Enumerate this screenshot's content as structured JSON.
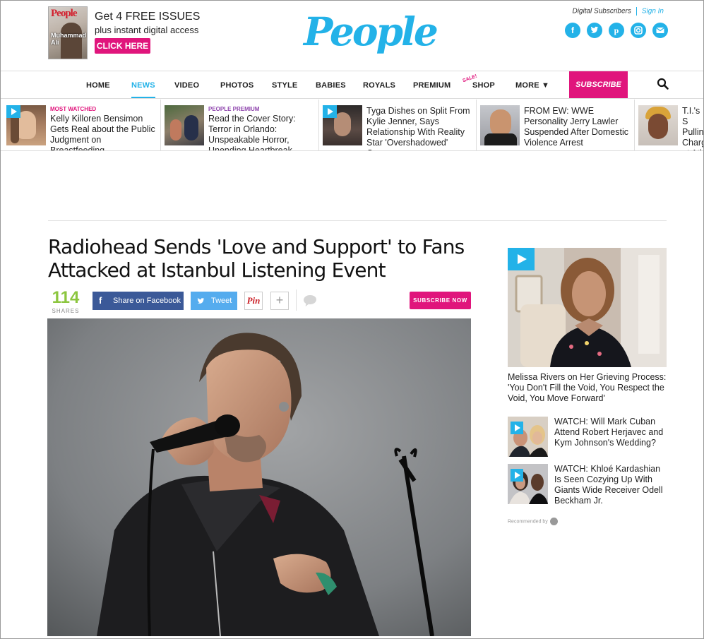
{
  "promo": {
    "cover_logo": "People",
    "cover_name": "Muhammad Ali",
    "line1": "Get 4 FREE ISSUES",
    "line2": "plus instant digital access",
    "cta": "CLICK HERE"
  },
  "brand": {
    "logo": "People",
    "accent": "#23b2e8",
    "pink": "#e0157c"
  },
  "account": {
    "digital_subscribers": "Digital Subscribers",
    "sign_in": "Sign In"
  },
  "social": [
    "facebook-icon",
    "twitter-icon",
    "pinterest-icon",
    "instagram-icon",
    "email-icon"
  ],
  "nav": {
    "items": [
      "HOME",
      "NEWS",
      "VIDEO",
      "PHOTOS",
      "STYLE",
      "BABIES",
      "ROYALS",
      "PREMIUM",
      "SHOP",
      "MORE ▼"
    ],
    "active": "NEWS",
    "sale_badge": "SALE!",
    "subscribe": "SUBSCRIBE"
  },
  "trending": [
    {
      "tag": "MOST WATCHED",
      "tag_color": "#e0157c",
      "text": "Kelly Killoren Bensimon Gets Real about the Public Judgment on Breastfeeding"
    },
    {
      "tag": "PEOPLE PREMIUM",
      "tag_color": "#8e44ad",
      "text": "Read the Cover Story: Terror in Orlando: Unspeakable Horror, Unending Heartbreak"
    },
    {
      "tag": "",
      "text": "Tyga Dishes on Split From Kylie Jenner, Says Relationship With Reality Star 'Overshadowed' Career"
    },
    {
      "tag": "",
      "text": "FROM EW: WWE Personality Jerry Lawler Suspended After Domestic Violence Arrest"
    },
    {
      "tag": "",
      "text": "T.I.'s S Pullins Charg at Atl"
    }
  ],
  "article": {
    "headline": "Radiohead Sends 'Love and Support' to Fans Attacked at Istanbul Listening Event",
    "shares_count": "114",
    "shares_label": "SHARES",
    "share_facebook": "Share on Facebook",
    "tweet": "Tweet",
    "pin": "Pin",
    "more": "+",
    "subscribe_now": "SUBSCRIBE NOW"
  },
  "sidebar": {
    "video_caption": "Melissa Rivers on Her Grieving Process: 'You Don't Fill the Void, You Respect the Void, You Move Forward'",
    "related": [
      "WATCH: Will Mark Cuban Attend Robert Herjavec and Kym Johnson's Wedding?",
      "WATCH: Khloé Kardashian Is Seen Cozying Up With Giants Wide Receiver Odell Beckham Jr."
    ],
    "recommended_by": "Recommended by"
  }
}
